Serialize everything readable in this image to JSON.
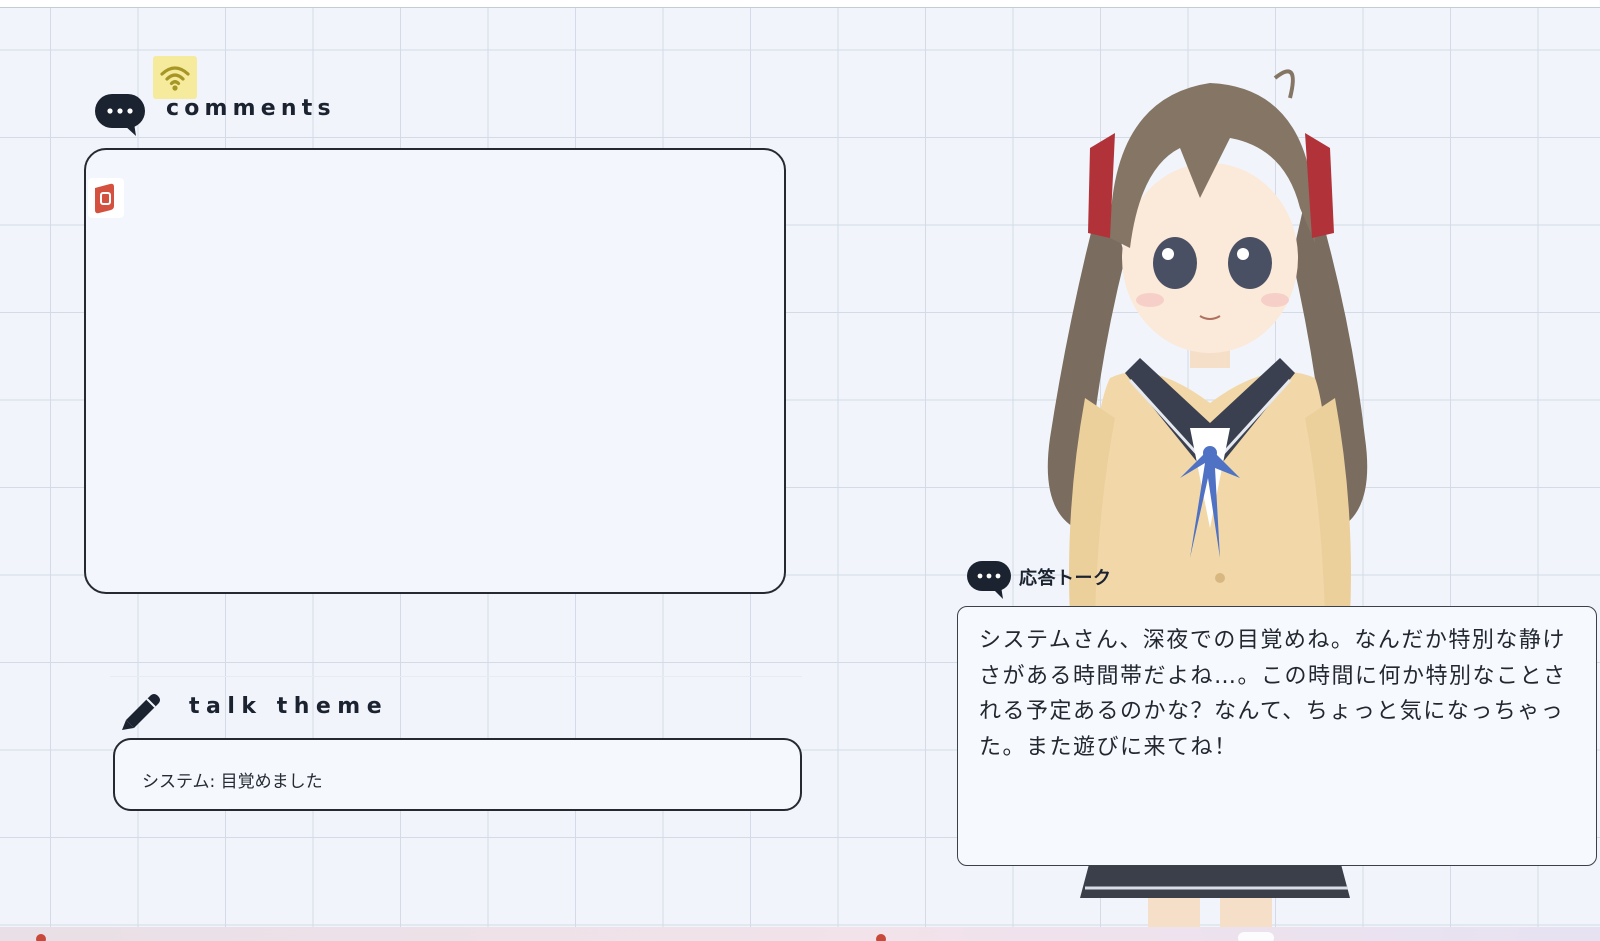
{
  "comments_section": {
    "title": "comments",
    "icons": [
      "speech-bubble-icon",
      "wifi-icon",
      "app-icon"
    ]
  },
  "talk_theme_section": {
    "title": "talk theme",
    "icon": "pencil-icon",
    "value": "システム: 目覚めました"
  },
  "response_section": {
    "title": "応答トーク",
    "icon": "speech-bubble-icon",
    "text": "システムさん、深夜での目覚めね。なんだか特別な静けさがある時間帯だよね…。この時間に何か特別なことされる予定あるのかな？なんて、ちょっと気になっちゃった。また遊びに来てね！"
  },
  "colors": {
    "background": "#f1f5fb",
    "grid_line": "#d4dbe6",
    "box_border": "#262a30",
    "icon_dark": "#1c2330",
    "wifi_badge": "#f6ea9c",
    "app_icon": "#d4503f"
  }
}
